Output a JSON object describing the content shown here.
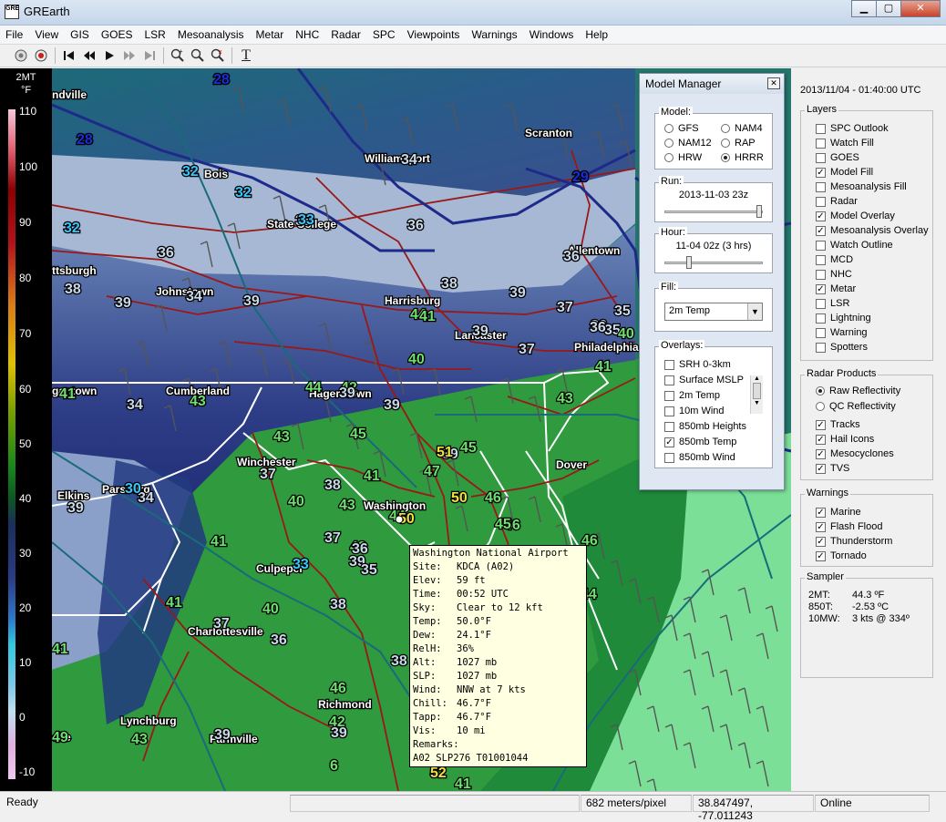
{
  "window": {
    "title": "GREarth",
    "app_icon_text": "GRE",
    "min_glyph": "▁",
    "max_glyph": "▢",
    "close_glyph": "✕"
  },
  "menu": [
    "File",
    "View",
    "GIS",
    "GOES",
    "LSR",
    "Mesoanalysis",
    "Metar",
    "NHC",
    "Radar",
    "SPC",
    "Viewpoints",
    "Warnings",
    "Windows",
    "Help"
  ],
  "toolbar": {
    "icons": [
      "layers-icon",
      "stop-icon",
      "first-frame-icon",
      "prev-frame-icon",
      "play-icon",
      "next-frame-icon",
      "last-frame-icon",
      "zoom-in-icon",
      "zoom-out-icon",
      "zoom-reset-icon",
      "text-tool-icon"
    ],
    "text_tool_glyph": "T"
  },
  "colorbar": {
    "title_line1": "2MT",
    "title_line2": "°F",
    "ticks": [
      "110",
      "100",
      "90",
      "80",
      "70",
      "60",
      "50",
      "40",
      "30",
      "20",
      "10",
      "0",
      "-10"
    ]
  },
  "map": {
    "cities": [
      {
        "name": "ndville"
      },
      {
        "name": "Bois"
      },
      {
        "name": "Williamsport"
      },
      {
        "name": "Scranton"
      },
      {
        "name": "State College"
      },
      {
        "name": "Allentown"
      },
      {
        "name": "ttsburgh"
      },
      {
        "name": "Johnstown"
      },
      {
        "name": "Harrisburg"
      },
      {
        "name": "Lancaster"
      },
      {
        "name": "Philadelphia"
      },
      {
        "name": "gantown"
      },
      {
        "name": "Cumberland"
      },
      {
        "name": "Hagerstown"
      },
      {
        "name": "Winchester"
      },
      {
        "name": "Dover"
      },
      {
        "name": "Elkins"
      },
      {
        "name": "Parsburg"
      },
      {
        "name": "Washington"
      },
      {
        "name": "Culpeper"
      },
      {
        "name": "Charlottesville"
      },
      {
        "name": "Lynchburg"
      },
      {
        "name": "Richmond"
      },
      {
        "name": "Farmville"
      },
      {
        "name": "oke"
      }
    ],
    "temps": [
      {
        "value": "28",
        "color": "#1a2dd6"
      },
      {
        "value": "28",
        "color": "#1a2dd6"
      },
      {
        "value": "32",
        "color": "#35c8ff"
      },
      {
        "value": "32",
        "color": "#35c8ff"
      },
      {
        "value": "32",
        "color": "#35c8ff"
      },
      {
        "value": "35",
        "color": "#c8d8e8"
      },
      {
        "value": "34",
        "color": "#c8d8e8"
      },
      {
        "value": "29",
        "color": "#1a2dd6"
      },
      {
        "value": "33",
        "color": "#35c8ff"
      },
      {
        "value": "36",
        "color": "#c8d8e8"
      },
      {
        "value": "36",
        "color": "#c8d8e8"
      },
      {
        "value": "35",
        "color": "#c8d8e8"
      },
      {
        "value": "36",
        "color": "#c8d8e8"
      },
      {
        "value": "38",
        "color": "#c8d8e8"
      },
      {
        "value": "39",
        "color": "#c8d8e8"
      },
      {
        "value": "34",
        "color": "#c8d8e8"
      },
      {
        "value": "39",
        "color": "#c8d8e8"
      },
      {
        "value": "38",
        "color": "#c8d8e8"
      },
      {
        "value": "39",
        "color": "#c8d8e8"
      },
      {
        "value": "36",
        "color": "#c8d8e8"
      },
      {
        "value": "35",
        "color": "#c8d8e8"
      },
      {
        "value": "37",
        "color": "#c8d8e8"
      },
      {
        "value": "44",
        "color": "#6ee06e"
      },
      {
        "value": "41",
        "color": "#6ee06e"
      },
      {
        "value": "39",
        "color": "#c8d8e8"
      },
      {
        "value": "37",
        "color": "#c8d8e8"
      },
      {
        "value": "36",
        "color": "#c8d8e8"
      },
      {
        "value": "40",
        "color": "#6ee06e"
      },
      {
        "value": "40",
        "color": "#6ee06e"
      },
      {
        "value": "41",
        "color": "#6ee06e"
      },
      {
        "value": "42",
        "color": "#6ee06e"
      },
      {
        "value": "44",
        "color": "#6ee06e"
      },
      {
        "value": "39",
        "color": "#c8d8e8"
      },
      {
        "value": "39",
        "color": "#c8d8e8"
      },
      {
        "value": "43",
        "color": "#6ee06e"
      },
      {
        "value": "43",
        "color": "#6ee06e"
      },
      {
        "value": "41",
        "color": "#6ee06e"
      },
      {
        "value": "34",
        "color": "#c8d8e8"
      },
      {
        "value": "43",
        "color": "#6ee06e"
      },
      {
        "value": "45",
        "color": "#6ee06e"
      },
      {
        "value": "39",
        "color": "#c8d8e8"
      },
      {
        "value": "51",
        "color": "#f0e040"
      },
      {
        "value": "45",
        "color": "#6ee06e"
      },
      {
        "value": "47",
        "color": "#6ee06e"
      },
      {
        "value": "37",
        "color": "#c8d8e8"
      },
      {
        "value": "41",
        "color": "#6ee06e"
      },
      {
        "value": "34",
        "color": "#c8d8e8"
      },
      {
        "value": "39",
        "color": "#c8d8e8"
      },
      {
        "value": "30",
        "color": "#35c8ff"
      },
      {
        "value": "38",
        "color": "#c8d8e8"
      },
      {
        "value": "43",
        "color": "#6ee06e"
      },
      {
        "value": "44",
        "color": "#6ee06e"
      },
      {
        "value": "50",
        "color": "#f0e040"
      },
      {
        "value": "46",
        "color": "#6ee06e"
      },
      {
        "value": "50",
        "color": "#f0e040"
      },
      {
        "value": "46",
        "color": "#6ee06e"
      },
      {
        "value": "45",
        "color": "#6ee06e"
      },
      {
        "value": "41",
        "color": "#6ee06e"
      },
      {
        "value": "37",
        "color": "#c8d8e8"
      },
      {
        "value": "40",
        "color": "#6ee06e"
      },
      {
        "value": "46",
        "color": "#6ee06e"
      },
      {
        "value": "39",
        "color": "#c8d8e8"
      },
      {
        "value": "33",
        "color": "#35c8ff"
      },
      {
        "value": "43",
        "color": "#6ee06e"
      },
      {
        "value": "36",
        "color": "#c8d8e8"
      },
      {
        "value": "35",
        "color": "#c8d8e8"
      },
      {
        "value": "41",
        "color": "#6ee06e"
      },
      {
        "value": "40",
        "color": "#6ee06e"
      },
      {
        "value": "38",
        "color": "#c8d8e8"
      },
      {
        "value": "44",
        "color": "#6ee06e"
      },
      {
        "value": "37",
        "color": "#c8d8e8"
      },
      {
        "value": "36",
        "color": "#c8d8e8"
      },
      {
        "value": "41",
        "color": "#6ee06e"
      },
      {
        "value": "46",
        "color": "#6ee06e"
      },
      {
        "value": "42",
        "color": "#6ee06e"
      },
      {
        "value": "43",
        "color": "#6ee06e"
      },
      {
        "value": "39",
        "color": "#c8d8e8"
      },
      {
        "value": "39",
        "color": "#c8d8e8"
      },
      {
        "value": "6",
        "color": "#6ee06e"
      },
      {
        "value": "49",
        "color": "#6ee06e"
      },
      {
        "value": "52",
        "color": "#f0e040"
      },
      {
        "value": "41",
        "color": "#6ee06e"
      },
      {
        "value": "38",
        "color": "#c8d8e8"
      }
    ]
  },
  "model_manager": {
    "title": "Model Manager",
    "close_glyph": "✕",
    "model_label": "Model:",
    "models": [
      {
        "label": "GFS",
        "selected": false
      },
      {
        "label": "NAM4",
        "selected": false
      },
      {
        "label": "NAM12",
        "selected": false
      },
      {
        "label": "RAP",
        "selected": false
      },
      {
        "label": "HRW",
        "selected": false
      },
      {
        "label": "HRRR",
        "selected": true
      }
    ],
    "run_label": "Run:",
    "run_value": "2013-11-03 23z",
    "hour_label": "Hour:",
    "hour_value": "11-04 02z (3 hrs)",
    "fill_label": "Fill:",
    "fill_value": "2m Temp",
    "dropdown_glyph": "▼",
    "overlays_label": "Overlays:",
    "overlays": [
      {
        "label": "SRH 0-3km",
        "checked": false
      },
      {
        "label": "Surface MSLP",
        "checked": false
      },
      {
        "label": "2m Temp",
        "checked": false
      },
      {
        "label": "10m Wind",
        "checked": false
      },
      {
        "label": "850mb Heights",
        "checked": false
      },
      {
        "label": "850mb Temp",
        "checked": true
      },
      {
        "label": "850mb Wind",
        "checked": false
      }
    ],
    "scroll_up_glyph": "▲",
    "scroll_down_glyph": "▼"
  },
  "right_panel": {
    "timestamp": "2013/11/04 - 01:40:00 UTC",
    "layers_label": "Layers",
    "layers": [
      {
        "label": "SPC Outlook",
        "checked": false
      },
      {
        "label": "Watch Fill",
        "checked": false
      },
      {
        "label": "GOES",
        "checked": false
      },
      {
        "label": "Model Fill",
        "checked": true
      },
      {
        "label": "Mesoanalysis Fill",
        "checked": false
      },
      {
        "label": "Radar",
        "checked": false
      },
      {
        "label": "Model Overlay",
        "checked": true
      },
      {
        "label": "Mesoanalysis Overlay",
        "checked": true
      },
      {
        "label": "Watch Outline",
        "checked": false
      },
      {
        "label": "MCD",
        "checked": false
      },
      {
        "label": "NHC",
        "checked": false
      },
      {
        "label": "Metar",
        "checked": true
      },
      {
        "label": "LSR",
        "checked": false
      },
      {
        "label": "Lightning",
        "checked": false
      },
      {
        "label": "Warning",
        "checked": false
      },
      {
        "label": "Spotters",
        "checked": false
      }
    ],
    "radar_label": "Radar Products",
    "radar_modes": [
      {
        "label": "Raw Reflectivity",
        "selected": true
      },
      {
        "label": "QC Reflectivity",
        "selected": false
      }
    ],
    "radar_options": [
      {
        "label": "Tracks",
        "checked": true
      },
      {
        "label": "Hail Icons",
        "checked": true
      },
      {
        "label": "Mesocyclones",
        "checked": true
      },
      {
        "label": "TVS",
        "checked": true
      }
    ],
    "warnings_label": "Warnings",
    "warnings": [
      {
        "label": "Marine",
        "checked": true
      },
      {
        "label": "Flash Flood",
        "checked": true
      },
      {
        "label": "Thunderstorm",
        "checked": true
      },
      {
        "label": "Tornado",
        "checked": true
      }
    ],
    "sampler_label": "Sampler",
    "sampler": [
      {
        "key": "2MT:",
        "value": "44.3 ºF"
      },
      {
        "key": "850T:",
        "value": "-2.53 ºC"
      },
      {
        "key": "10MW:",
        "value": "3 kts @ 334º"
      }
    ]
  },
  "tooltip": {
    "title": "Washington National Airport",
    "rows": [
      {
        "key": "Site:",
        "value": "KDCA (A02)"
      },
      {
        "key": "Elev:",
        "value": "59 ft"
      },
      {
        "key": "Time:",
        "value": "00:52 UTC"
      },
      {
        "key": "Sky:",
        "value": "Clear to 12 kft"
      },
      {
        "key": "Temp:",
        "value": "50.0°F"
      },
      {
        "key": "Dew:",
        "value": "24.1°F"
      },
      {
        "key": "RelH:",
        "value": "36%"
      },
      {
        "key": "Alt:",
        "value": "1027 mb"
      },
      {
        "key": "SLP:",
        "value": "1027 mb"
      },
      {
        "key": "Wind:",
        "value": "NNW at 7 kts"
      },
      {
        "key": "Chill:",
        "value": "46.7°F"
      },
      {
        "key": "Tapp:",
        "value": "46.7°F"
      },
      {
        "key": "Vis:",
        "value": "10 mi"
      }
    ],
    "remarks_label": "Remarks:",
    "remarks": "A02 SLP276 T01001044"
  },
  "status": {
    "ready": "Ready",
    "scale": "682 meters/pixel",
    "coords": "38.847497, -77.011243",
    "connection": "Online"
  }
}
